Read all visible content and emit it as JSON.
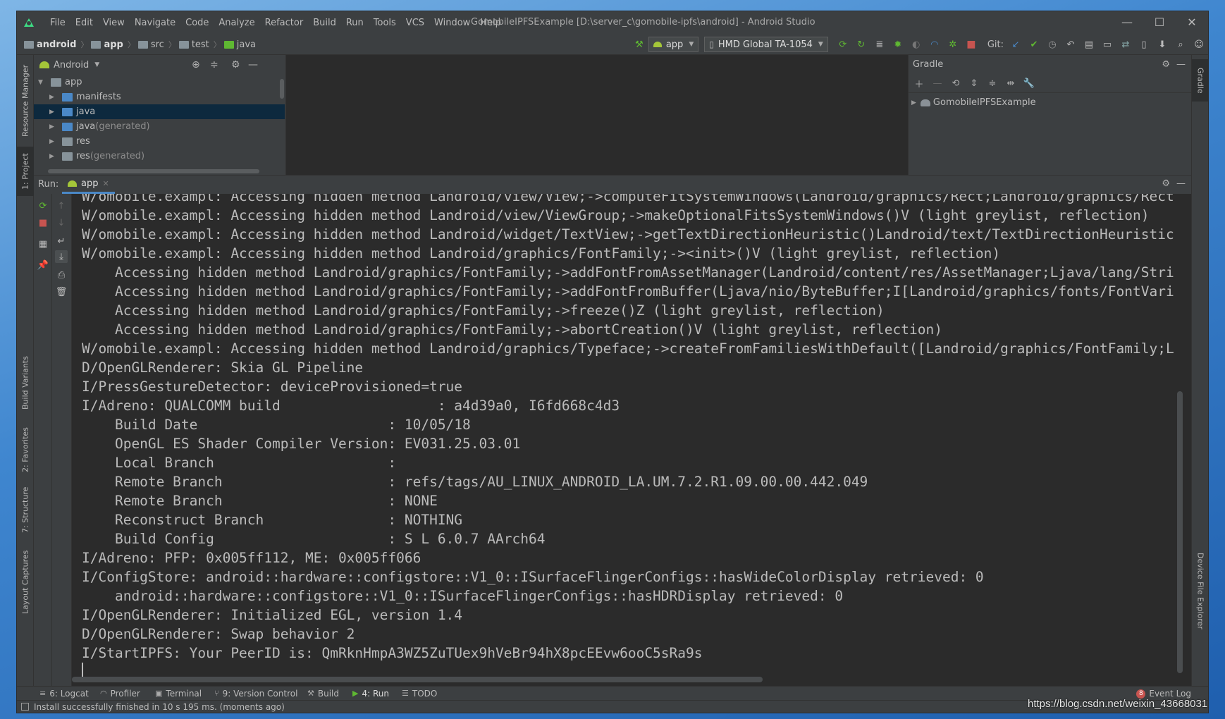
{
  "window": {
    "title": "GomobileIPFSExample [D:\\server_c\\gomobile-ipfs\\android] - Android Studio",
    "controls": {
      "minimize": "—",
      "maximize": "☐",
      "close": "✕"
    }
  },
  "menu": [
    "File",
    "Edit",
    "View",
    "Navigate",
    "Code",
    "Analyze",
    "Refactor",
    "Build",
    "Run",
    "Tools",
    "VCS",
    "Window",
    "Help"
  ],
  "breadcrumb": [
    {
      "label": "android",
      "bold": true
    },
    {
      "label": "app",
      "bold": true
    },
    {
      "label": "src",
      "bold": false
    },
    {
      "label": "test",
      "bold": false
    },
    {
      "label": "java",
      "bold": false
    }
  ],
  "toolbar": {
    "run_config": "app",
    "device": "HMD Global TA-1054",
    "git_label": "Git:"
  },
  "project_panel": {
    "view_mode": "Android",
    "tree": [
      {
        "label": "app",
        "indent": 0,
        "expanded": true,
        "note": "",
        "selected": false,
        "color": "#87939a"
      },
      {
        "label": "manifests",
        "indent": 1,
        "expanded": false,
        "note": "",
        "selected": false,
        "color": "#4a88c7"
      },
      {
        "label": "java",
        "indent": 1,
        "expanded": false,
        "note": "",
        "selected": true,
        "color": "#4a88c7"
      },
      {
        "label": "java",
        "indent": 1,
        "expanded": false,
        "note": " (generated)",
        "selected": false,
        "color": "#4a88c7"
      },
      {
        "label": "res",
        "indent": 1,
        "expanded": false,
        "note": "",
        "selected": false,
        "color": "#87939a"
      },
      {
        "label": "res",
        "indent": 1,
        "expanded": false,
        "note": " (generated)",
        "selected": false,
        "color": "#87939a"
      }
    ]
  },
  "gradle_panel": {
    "title": "Gradle",
    "project": "GomobileIPFSExample"
  },
  "run_panel": {
    "label": "Run:",
    "tab": "app",
    "lines": [
      "W/omobile.exampl: Accessing hidden method Landroid/view/View;->computeFitSystemWindows(Landroid/graphics/Rect;Landroid/graphics/Rect",
      "W/omobile.exampl: Accessing hidden method Landroid/view/ViewGroup;->makeOptionalFitsSystemWindows()V (light greylist, reflection)",
      "W/omobile.exampl: Accessing hidden method Landroid/widget/TextView;->getTextDirectionHeuristic()Landroid/text/TextDirectionHeuristic",
      "W/omobile.exampl: Accessing hidden method Landroid/graphics/FontFamily;-><init>()V (light greylist, reflection)",
      "    Accessing hidden method Landroid/graphics/FontFamily;->addFontFromAssetManager(Landroid/content/res/AssetManager;Ljava/lang/Stri",
      "    Accessing hidden method Landroid/graphics/FontFamily;->addFontFromBuffer(Ljava/nio/ByteBuffer;I[Landroid/graphics/fonts/FontVari",
      "    Accessing hidden method Landroid/graphics/FontFamily;->freeze()Z (light greylist, reflection)",
      "    Accessing hidden method Landroid/graphics/FontFamily;->abortCreation()V (light greylist, reflection)",
      "W/omobile.exampl: Accessing hidden method Landroid/graphics/Typeface;->createFromFamiliesWithDefault([Landroid/graphics/FontFamily;L",
      "D/OpenGLRenderer: Skia GL Pipeline",
      "I/PressGestureDetector: deviceProvisioned=true",
      "I/Adreno: QUALCOMM build                   : a4d39a0, I6fd668c4d3",
      "    Build Date                       : 10/05/18",
      "    OpenGL ES Shader Compiler Version: EV031.25.03.01",
      "    Local Branch                     : ",
      "    Remote Branch                    : refs/tags/AU_LINUX_ANDROID_LA.UM.7.2.R1.09.00.00.442.049",
      "    Remote Branch                    : NONE",
      "    Reconstruct Branch               : NOTHING",
      "    Build Config                     : S L 6.0.7 AArch64",
      "I/Adreno: PFP: 0x005ff112, ME: 0x005ff066",
      "I/ConfigStore: android::hardware::configstore::V1_0::ISurfaceFlingerConfigs::hasWideColorDisplay retrieved: 0",
      "    android::hardware::configstore::V1_0::ISurfaceFlingerConfigs::hasHDRDisplay retrieved: 0",
      "I/OpenGLRenderer: Initialized EGL, version 1.4",
      "D/OpenGLRenderer: Swap behavior 2",
      "I/StartIPFS: Your PeerID is: QmRknHmpA3WZ5ZuTUex9hVeBr94hX8pcEEvw6ooC5sRa9s"
    ]
  },
  "left_stripe": {
    "resource_manager": "Resource Manager",
    "project": "1: Project",
    "build_variants": "Build Variants",
    "favorites": "2: Favorites",
    "structure": "7: Structure",
    "layout_captures": "Layout Captures"
  },
  "right_stripe": {
    "gradle": "Gradle",
    "device_file_explorer": "Device File Explorer"
  },
  "bottom_tabs": {
    "logcat": "6: Logcat",
    "profiler": "Profiler",
    "terminal": "Terminal",
    "version_control": "9: Version Control",
    "build": "Build",
    "run": "4: Run",
    "todo": "TODO",
    "event_log_count": "8",
    "event_log": "Event Log"
  },
  "status": {
    "message": "Install successfully finished in 10 s 195 ms. (moments ago)"
  },
  "watermark": "https://blog.csdn.net/weixin_43668031"
}
